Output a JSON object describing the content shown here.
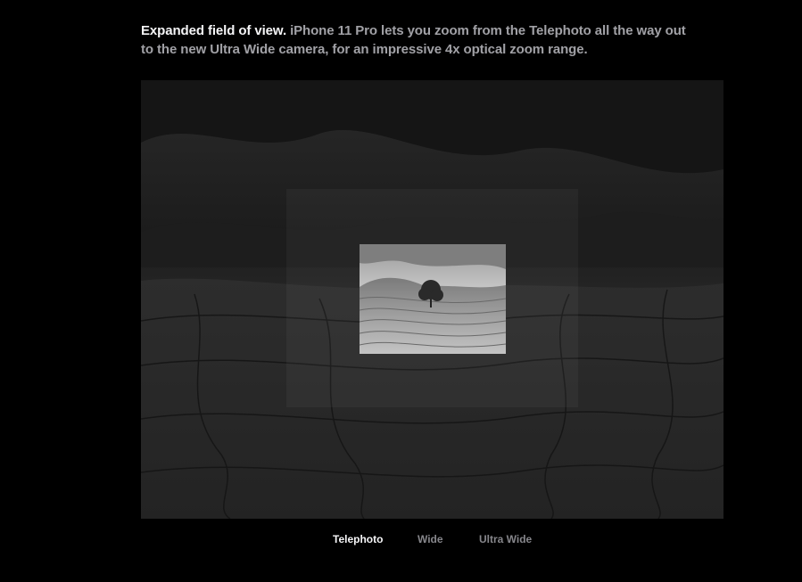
{
  "intro": {
    "lead": "Expanded field of view.",
    "body": " iPhone 11 Pro lets you zoom from the Telephoto all the way out to the new Ultra Wide camera, for an impressive 4x optical zoom range."
  },
  "zoom_tabs": [
    {
      "label": "Telephoto",
      "active": true
    },
    {
      "label": "Wide",
      "active": false
    },
    {
      "label": "Ultra Wide",
      "active": false
    }
  ],
  "colors": {
    "background": "#000000",
    "headline": "#f5f5f7",
    "body_text": "#a1a1a6",
    "inactive_tab": "#86868b"
  }
}
